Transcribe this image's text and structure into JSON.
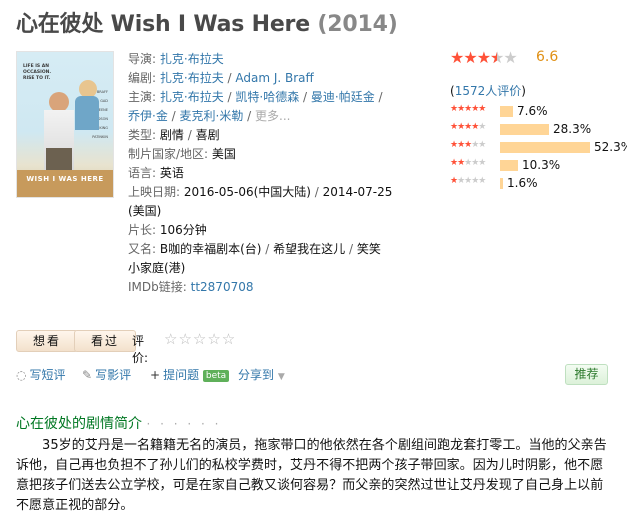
{
  "title": {
    "cn": "心在彼处",
    "en": "Wish I Was Here",
    "year": "(2014)"
  },
  "poster": {
    "title_text": "WISH I WAS HERE",
    "tagline": "LIFE IS AN OCCASION. RISE TO IT.",
    "cast_names": [
      "BRAFF",
      "GAD",
      "GREENE",
      "HUDSON",
      "KING",
      "PATINKIN"
    ]
  },
  "info": {
    "director_label": "导演:",
    "director": "扎克·布拉夫",
    "writer_label": "编剧:",
    "writers": [
      "扎克·布拉夫",
      "Adam J. Braff"
    ],
    "cast_label": "主演:",
    "cast_line1": [
      "扎克·布拉夫",
      "凯特·哈德森",
      "曼迪·帕廷金"
    ],
    "cast_line2": [
      "乔伊·金",
      "麦克利·米勒"
    ],
    "more": "更多...",
    "genre_label": "类型:",
    "genres": [
      "剧情",
      "喜剧"
    ],
    "country_label": "制片国家/地区:",
    "country": "美国",
    "language_label": "语言:",
    "language": "英语",
    "release_label": "上映日期:",
    "release1": "2016-05-06(中国大陆)",
    "release2": "2014-07-25",
    "release2_region": "(美国)",
    "runtime_label": "片长:",
    "runtime": "106分钟",
    "aka_label": "又名:",
    "aka1": "B咖的幸福剧本(台)",
    "aka2": "希望我在这儿",
    "aka3": "笑笑",
    "aka4": "小家庭(港)",
    "imdb_label": "IMDb链接:",
    "imdb": "tt2870708"
  },
  "rating": {
    "score": "6.6",
    "stars_filled": 3.5,
    "votes": "1572人评价",
    "distribution": [
      {
        "stars": 5,
        "percent": "7.6%",
        "value": 7.6
      },
      {
        "stars": 4,
        "percent": "28.3%",
        "value": 28.3
      },
      {
        "stars": 3,
        "percent": "52.3%",
        "value": 52.3
      },
      {
        "stars": 2,
        "percent": "10.3%",
        "value": 10.3
      },
      {
        "stars": 1,
        "percent": "1.6%",
        "value": 1.6
      }
    ]
  },
  "actions": {
    "want_label": "想看",
    "seen_label": "看过",
    "rate_label": "评价:",
    "write_short": "写短评",
    "write_review": "写影评",
    "ask": "提问题",
    "beta": "beta",
    "share": "分享到",
    "recommend": "推荐"
  },
  "summary": {
    "heading": "心在彼处的剧情简介",
    "dots": "· · · · · ·",
    "text": "35岁的艾丹是一名籍籍无名的演员，拖家带口的他依然在各个剧组间跑龙套打零工。当他的父亲告诉他，自己再也负担不了孙儿们的私校学费时，艾丹不得不把两个孩子带回家。因为儿时阴影，他不愿意把孩子们送去公立学校，可是在家自己教又谈何容易？而父亲的突然过世让艾丹发现了自己身上以前不愿意正视的部分。"
  },
  "colors": {
    "link": "#3377aa",
    "star": "#ff5138",
    "bar": "#ffd596",
    "score": "#e09015",
    "section": "#007722"
  }
}
